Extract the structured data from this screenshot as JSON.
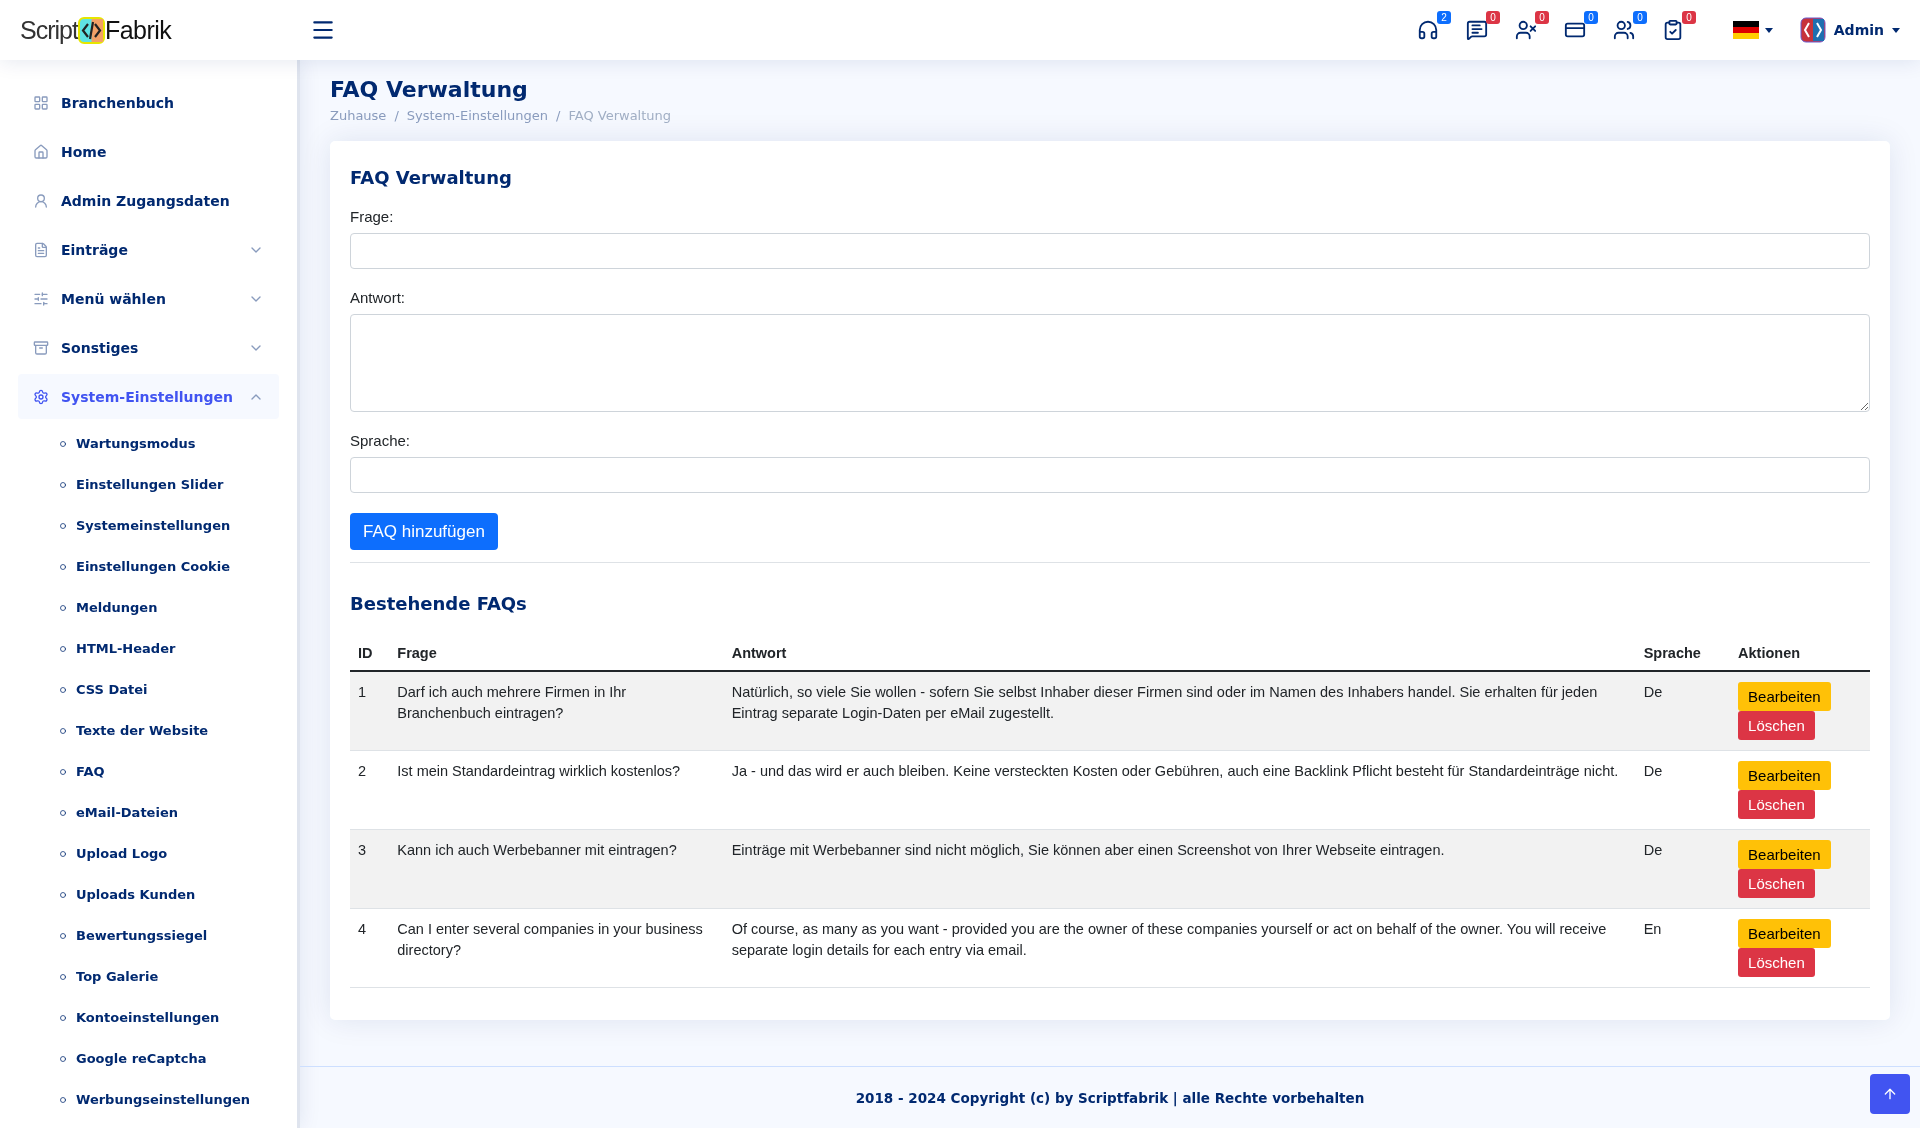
{
  "header": {
    "logo": {
      "left": "Script",
      "right": "Fabrik"
    },
    "notifications": [
      {
        "kind": "headset",
        "count": "2",
        "color": "#0d6efd"
      },
      {
        "kind": "chat",
        "count": "0",
        "color": "#dc3545"
      },
      {
        "kind": "user-x",
        "count": "0",
        "color": "#dc3545"
      },
      {
        "kind": "card",
        "count": "0",
        "color": "#0d6efd"
      },
      {
        "kind": "users",
        "count": "0",
        "color": "#0d6efd"
      },
      {
        "kind": "clipboard",
        "count": "0",
        "color": "#dc3545"
      }
    ],
    "user": "Admin"
  },
  "sidebar": {
    "items": [
      {
        "kind": "grid",
        "label": "Branchenbuch",
        "selected": false
      },
      {
        "kind": "home",
        "label": "Home",
        "selected": false
      },
      {
        "kind": "user",
        "label": "Admin Zugangsdaten",
        "selected": false
      },
      {
        "kind": "file",
        "label": "Einträge",
        "selected": false,
        "expanded": false
      },
      {
        "kind": "sliders",
        "label": "Menü wählen",
        "selected": false,
        "expanded": false
      },
      {
        "kind": "box",
        "label": "Sonstiges",
        "selected": false,
        "expanded": false
      },
      {
        "kind": "gear",
        "label": "System-Einstellungen",
        "selected": true,
        "expanded": true,
        "children": [
          {
            "label": "Wartungsmodus",
            "selected": false
          },
          {
            "label": "Einstellungen Slider",
            "selected": false
          },
          {
            "label": "Systemeinstellungen",
            "selected": false
          },
          {
            "label": "Einstellungen Cookie",
            "selected": false
          },
          {
            "label": "Meldungen",
            "selected": false
          },
          {
            "label": "HTML-Header",
            "selected": false
          },
          {
            "label": "CSS Datei",
            "selected": false
          },
          {
            "label": "Texte der Website",
            "selected": false
          },
          {
            "label": "FAQ",
            "selected": false
          },
          {
            "label": "eMail-Dateien",
            "selected": false
          },
          {
            "label": "Upload Logo",
            "selected": false
          },
          {
            "label": "Uploads Kunden",
            "selected": false
          },
          {
            "label": "Bewertungssiegel",
            "selected": false
          },
          {
            "label": "Top Galerie",
            "selected": false
          },
          {
            "label": "Kontoeinstellungen",
            "selected": false
          },
          {
            "label": "Google reCaptcha",
            "selected": false
          },
          {
            "label": "Werbungseinstellungen",
            "selected": false
          }
        ]
      }
    ]
  },
  "page": {
    "title": "FAQ Verwaltung",
    "breadcrumb": [
      "Zuhause",
      "System-Einstellungen",
      "FAQ Verwaltung"
    ],
    "separator": "/"
  },
  "form": {
    "title": "FAQ Verwaltung",
    "fields": [
      {
        "label": "Frage:",
        "kind": "input"
      },
      {
        "label": "Antwort:",
        "kind": "textarea"
      },
      {
        "label": "Sprache:",
        "kind": "input"
      }
    ],
    "submit": "FAQ hinzufügen"
  },
  "table": {
    "title": "Bestehende FAQs",
    "columns": [
      "ID",
      "Frage",
      "Antwort",
      "Sprache",
      "Aktionen"
    ],
    "rows": [
      {
        "id": "1",
        "frage": "Darf ich auch mehrere Firmen in Ihr Branchenbuch eintragen?",
        "antwort": "Natürlich, so viele Sie wollen - sofern Sie selbst Inhaber dieser Firmen sind oder im Namen des Inhabers handel. Sie erhalten für jeden Eintrag separate Login-Daten per eMail zugestellt.",
        "sprache": "De",
        "edit": "Bearbeiten",
        "delete": "Löschen"
      },
      {
        "id": "2",
        "frage": "Ist mein Standardeintrag wirklich kostenlos?",
        "antwort": "Ja - und das wird er auch bleiben. Keine versteckten Kosten oder Gebühren, auch eine Backlink Pflicht besteht für Standardeinträge nicht.",
        "sprache": "De",
        "edit": "Bearbeiten",
        "delete": "Löschen"
      },
      {
        "id": "3",
        "frage": "Kann ich auch Werbebanner mit eintragen?",
        "antwort": "Einträge mit Werbebanner sind nicht möglich, Sie können aber einen Screenshot von Ihrer Webseite eintragen.",
        "sprache": "De",
        "edit": "Bearbeiten",
        "delete": "Löschen"
      },
      {
        "id": "4",
        "frage": "Can I enter several companies in your business directory?",
        "antwort": "Of course, as many as you want - provided you are the owner of these companies yourself or act on behalf of the owner. You will receive separate login details for each entry via email.",
        "sprache": "En",
        "edit": "Bearbeiten",
        "delete": "Löschen"
      }
    ]
  },
  "footer": "2018 - 2024 Copyright (c) by Scriptfabrik | alle Rechte vorbehalten"
}
